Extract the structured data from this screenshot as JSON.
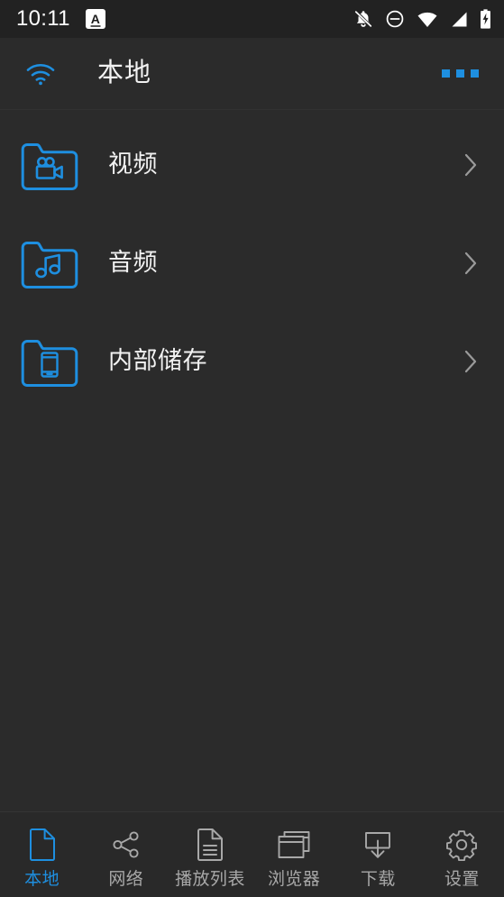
{
  "colors": {
    "background": "#2b2b2b",
    "statusbar_bg": "#222222",
    "accent": "#1e8fe0",
    "text_primary": "#f2f2f2",
    "text_muted": "#a8a8a8",
    "divider": "#343434"
  },
  "statusbar": {
    "time": "10:11",
    "ime_indicator": "A",
    "icons": [
      {
        "name": "notifications-off-icon"
      },
      {
        "name": "do-not-disturb-icon"
      },
      {
        "name": "wifi-icon"
      },
      {
        "name": "cellular-signal-icon"
      },
      {
        "name": "battery-charging-icon"
      }
    ]
  },
  "appbar": {
    "wifi_icon": "wifi-icon",
    "title": "本地",
    "overflow_icon": "overflow-menu-icon"
  },
  "list": {
    "items": [
      {
        "label": "视频",
        "icon": "folder-video-icon",
        "chevron": "chevron-right-icon"
      },
      {
        "label": "音频",
        "icon": "folder-audio-icon",
        "chevron": "chevron-right-icon"
      },
      {
        "label": "内部储存",
        "icon": "folder-internal-storage-icon",
        "chevron": "chevron-right-icon"
      }
    ]
  },
  "bottomnav": {
    "items": [
      {
        "label": "本地",
        "icon": "file-icon",
        "active": true
      },
      {
        "label": "网络",
        "icon": "share-icon",
        "active": false
      },
      {
        "label": "播放列表",
        "icon": "playlist-icon",
        "active": false
      },
      {
        "label": "浏览器",
        "icon": "browser-icon",
        "active": false
      },
      {
        "label": "下载",
        "icon": "download-icon",
        "active": false
      },
      {
        "label": "设置",
        "icon": "settings-icon",
        "active": false
      }
    ]
  }
}
